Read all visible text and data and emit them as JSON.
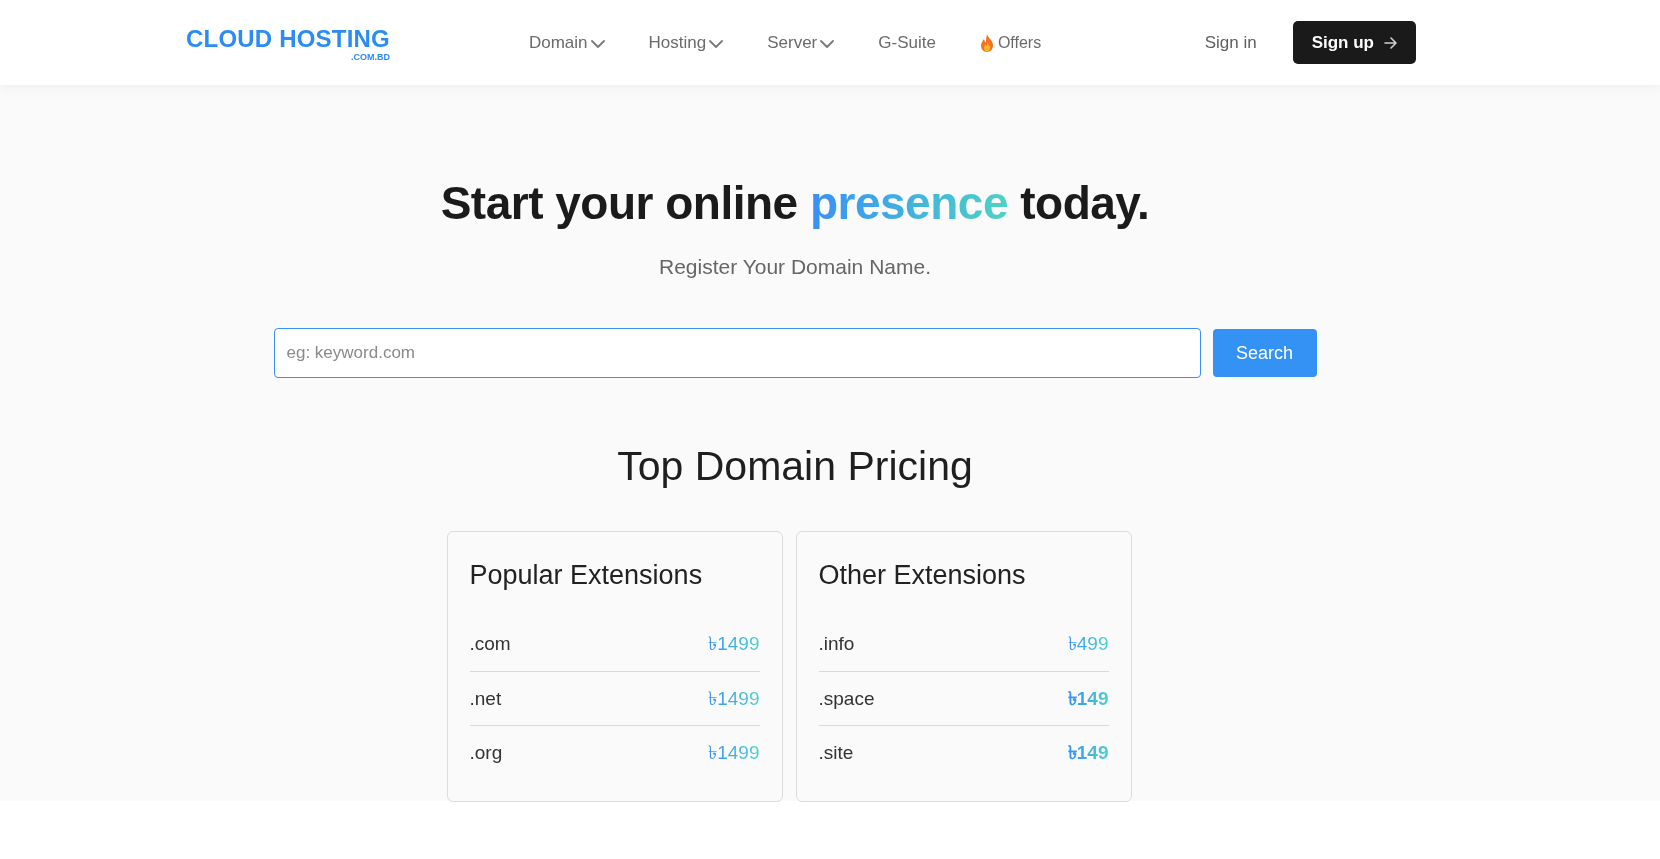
{
  "header": {
    "logo": {
      "name": "CLOUD HOSTING",
      "suffix": ".COM.BD"
    },
    "nav": [
      {
        "label": "Domain",
        "kind": "dropdown"
      },
      {
        "label": "Hosting",
        "kind": "dropdown"
      },
      {
        "label": "Server",
        "kind": "dropdown"
      },
      {
        "label": "G-Suite",
        "kind": "link"
      },
      {
        "label": "Offers",
        "kind": "promo"
      }
    ],
    "sign_in": "Sign in",
    "sign_up": "Sign up"
  },
  "hero": {
    "title": [
      {
        "text": "Start your online",
        "highlighted": false
      },
      {
        "text": "presence",
        "highlighted": true
      },
      {
        "text": "today.",
        "highlighted": false
      }
    ],
    "subtitle": "Register Your Domain Name.",
    "search": {
      "placeholder": "eg: keyword.com",
      "button": "Search"
    }
  },
  "pricing": {
    "title": "Top Domain Pricing",
    "groups": [
      {
        "title": "Popular Extensions",
        "rows": [
          {
            "extension": ".com",
            "price": "৳1499",
            "emphasized": false
          },
          {
            "extension": ".net",
            "price": "৳1499",
            "emphasized": false
          },
          {
            "extension": ".org",
            "price": "৳1499",
            "emphasized": false
          }
        ]
      },
      {
        "title": "Other Extensions",
        "rows": [
          {
            "extension": ".info",
            "price": "৳499",
            "emphasized": false
          },
          {
            "extension": ".space",
            "price": "৳149",
            "emphasized": true
          },
          {
            "extension": ".site",
            "price": "৳149",
            "emphasized": true
          }
        ]
      }
    ]
  }
}
